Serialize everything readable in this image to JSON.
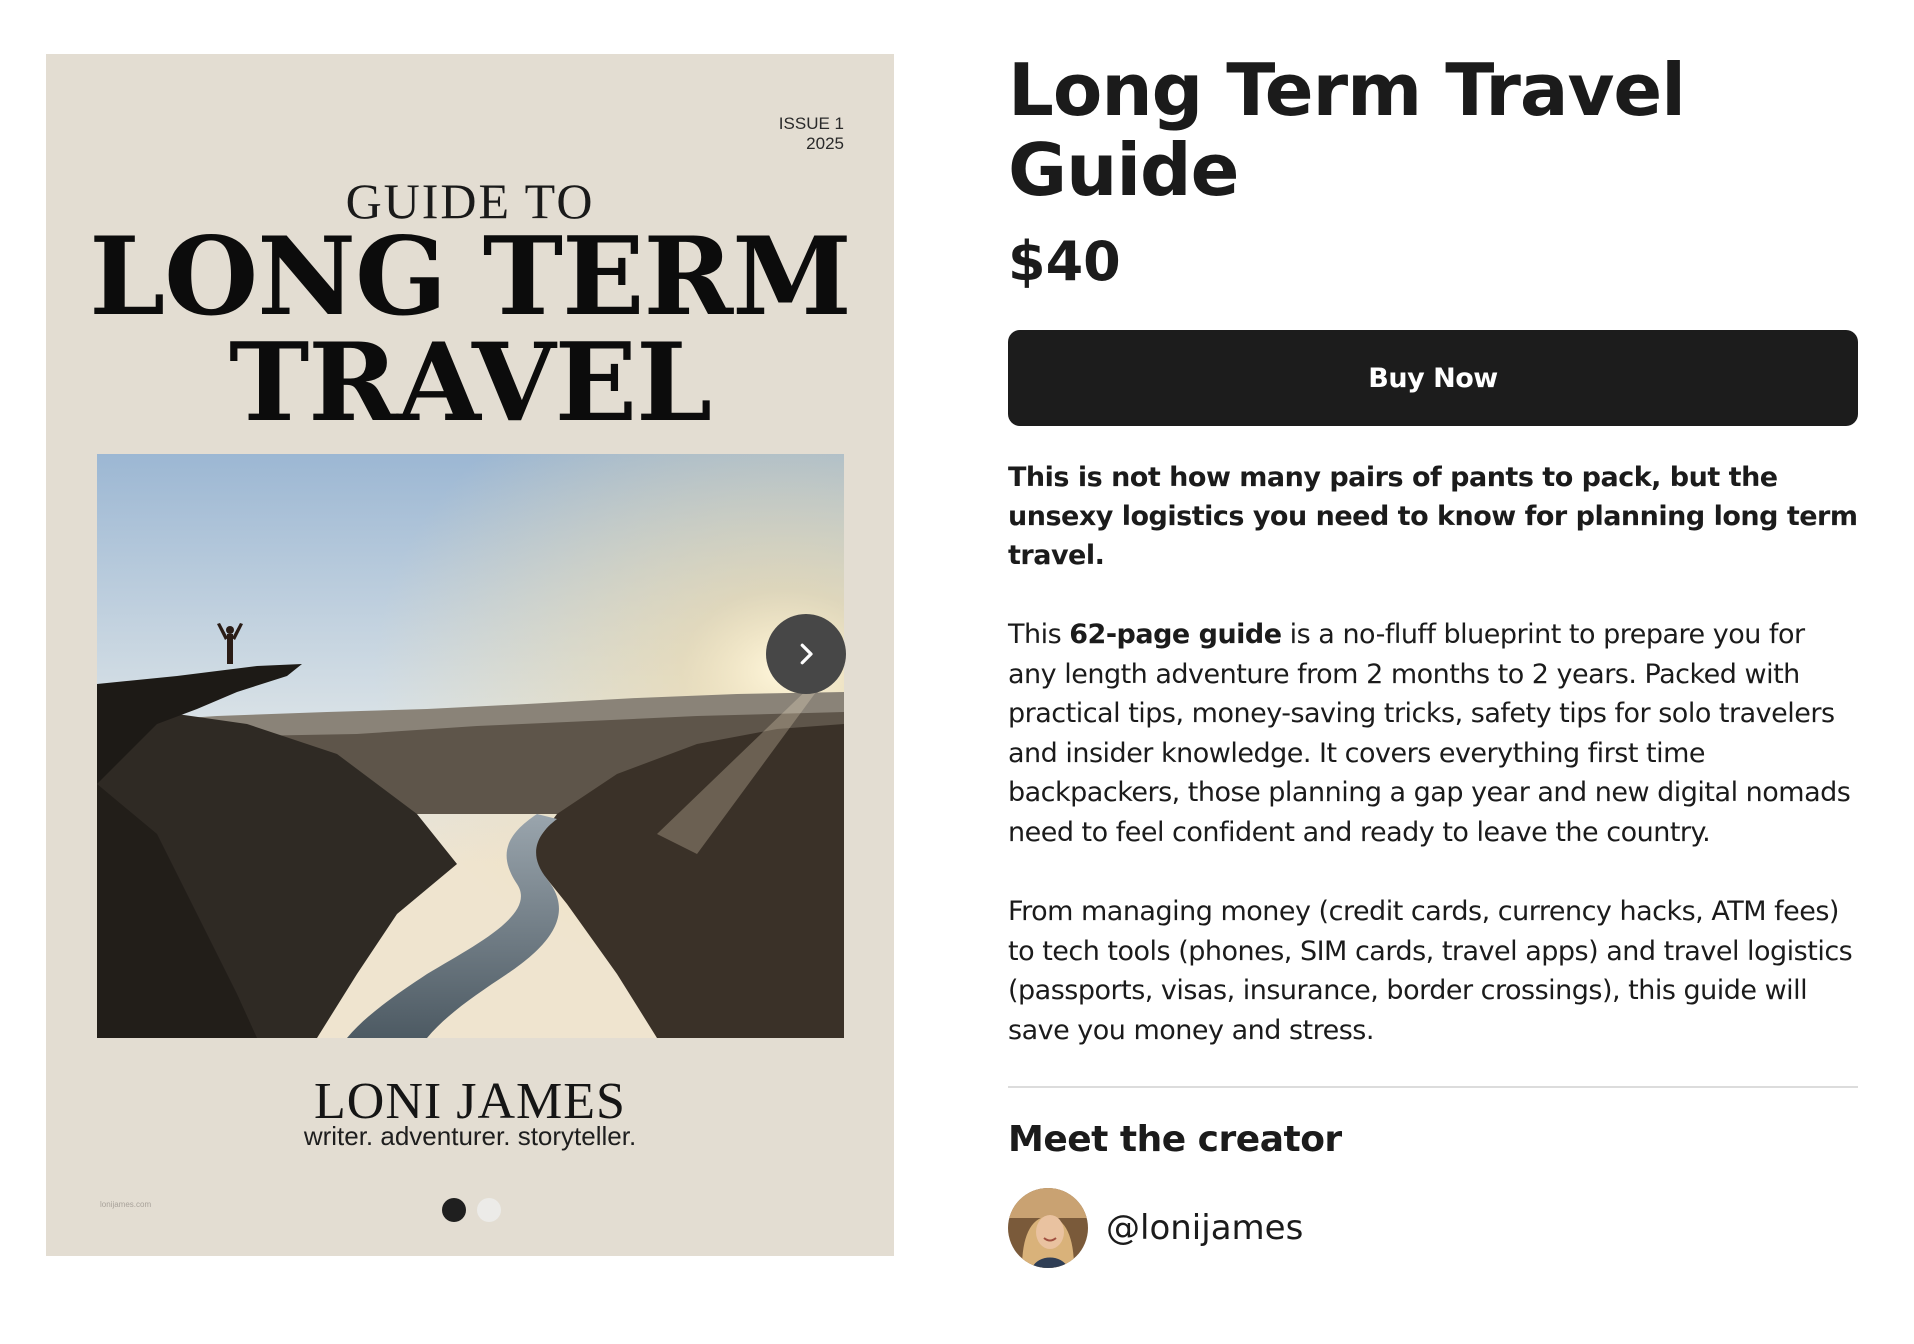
{
  "cover": {
    "issue_line1": "ISSUE 1",
    "issue_line2": "2025",
    "guide_to": "GUIDE TO",
    "title_line1": "LONG TERM",
    "title_line2": "TRAVEL",
    "author_name": "LONI JAMES",
    "author_tagline": "writer. adventurer. storyteller.",
    "site_url": "lonijames.com",
    "photo_icon": "landscape-photo",
    "next_icon": "chevron-right-icon"
  },
  "carousel": {
    "slide_count": 2,
    "active_index": 0
  },
  "product": {
    "title": "Long Term Travel Guide",
    "price": "$40",
    "buy_label": "Buy Now",
    "intro": "This is not how many pairs of pants to pack, but the unsexy logistics you need to know for planning long term travel.",
    "para1_prefix": "This ",
    "para1_bold": "62-page guide",
    "para1_rest": " is a no-fluff blueprint to prepare you for any length adventure from 2 months to 2 years. Packed with practical tips, money-saving tricks, safety tips for solo travelers and insider knowledge. It covers everything first time backpackers, those planning a gap year and new digital nomads need to feel confident and ready to leave the country.",
    "para2": "From managing money (credit cards, currency hacks, ATM fees) to tech tools (phones, SIM cards, travel apps) and travel logistics (passports, visas, insurance, border crossings), this guide will save you money and stress."
  },
  "creator": {
    "heading": "Meet the creator",
    "handle": "@lonijames",
    "avatar_icon": "avatar-photo"
  },
  "colors": {
    "cover_bg": "#e3ddd2",
    "button_bg": "#1c1c1c",
    "text": "#1b1b1b"
  }
}
